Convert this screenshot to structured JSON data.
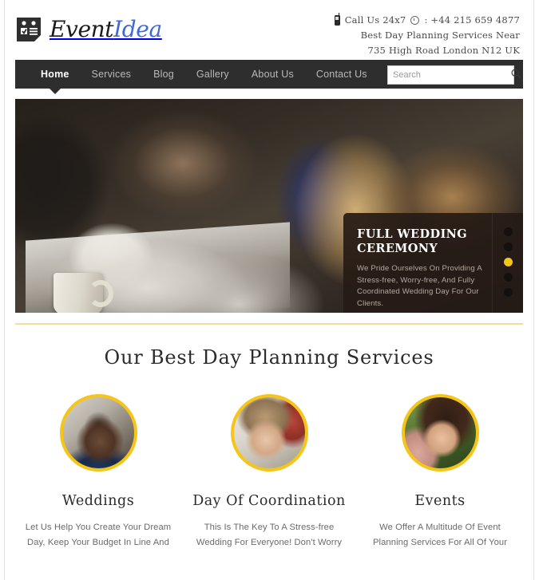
{
  "header": {
    "logo": {
      "icon": "clipboard-checklist-icon",
      "text_primary": "Event",
      "text_accent": "Idea",
      "accent_color": "#4169d6"
    },
    "contact": {
      "phone_icon": "mobile-phone-icon",
      "clock_icon": "clock-icon",
      "line1_prefix": "Call Us 24x7",
      "line1_suffix": ": +44 215 659 4877",
      "line2": "Best Day Planning Services Near",
      "line3": "735 High Road London N12 UK"
    }
  },
  "nav": {
    "items": [
      {
        "label": "Home",
        "active": true
      },
      {
        "label": "Services",
        "active": false
      },
      {
        "label": "Blog",
        "active": false
      },
      {
        "label": "Gallery",
        "active": false
      },
      {
        "label": "About Us",
        "active": false
      },
      {
        "label": "Contact Us",
        "active": false
      }
    ],
    "search": {
      "placeholder": "Search",
      "value": "",
      "icon": "search-icon"
    },
    "bar_color": "#2e2e2e"
  },
  "hero": {
    "alt": "People planning at a table with coffee mug and notebook",
    "caption": {
      "title": "FULL WEDDING CEREMONY",
      "body": "We Pride Ourselves On Providing A Stress-free, Worry-free, And Fully Coordinated Wedding Day For Our Clients."
    },
    "slider": {
      "total_dots": 5,
      "active_index": 3,
      "active_color": "#f5c518",
      "inactive_color": "#141010"
    }
  },
  "divider_color": "#f2dd9a",
  "services": {
    "title": "Our Best Day Planning Services",
    "accent_ring_color": "#f5c518",
    "cards": [
      {
        "avatar": "avatar-smiling-man",
        "title": "Weddings",
        "body": "Let Us Help You Create Your Dream Day, Keep Your Budget In Line And"
      },
      {
        "avatar": "avatar-blonde-woman",
        "title": "Day Of Coordination",
        "body": "This Is The Key To A Stress-free Wedding For Everyone! Don't Worry"
      },
      {
        "avatar": "avatar-woman-on-phone",
        "title": "Events",
        "body": "We Offer A Multitude Of Event Planning Services For All Of Your"
      }
    ]
  }
}
